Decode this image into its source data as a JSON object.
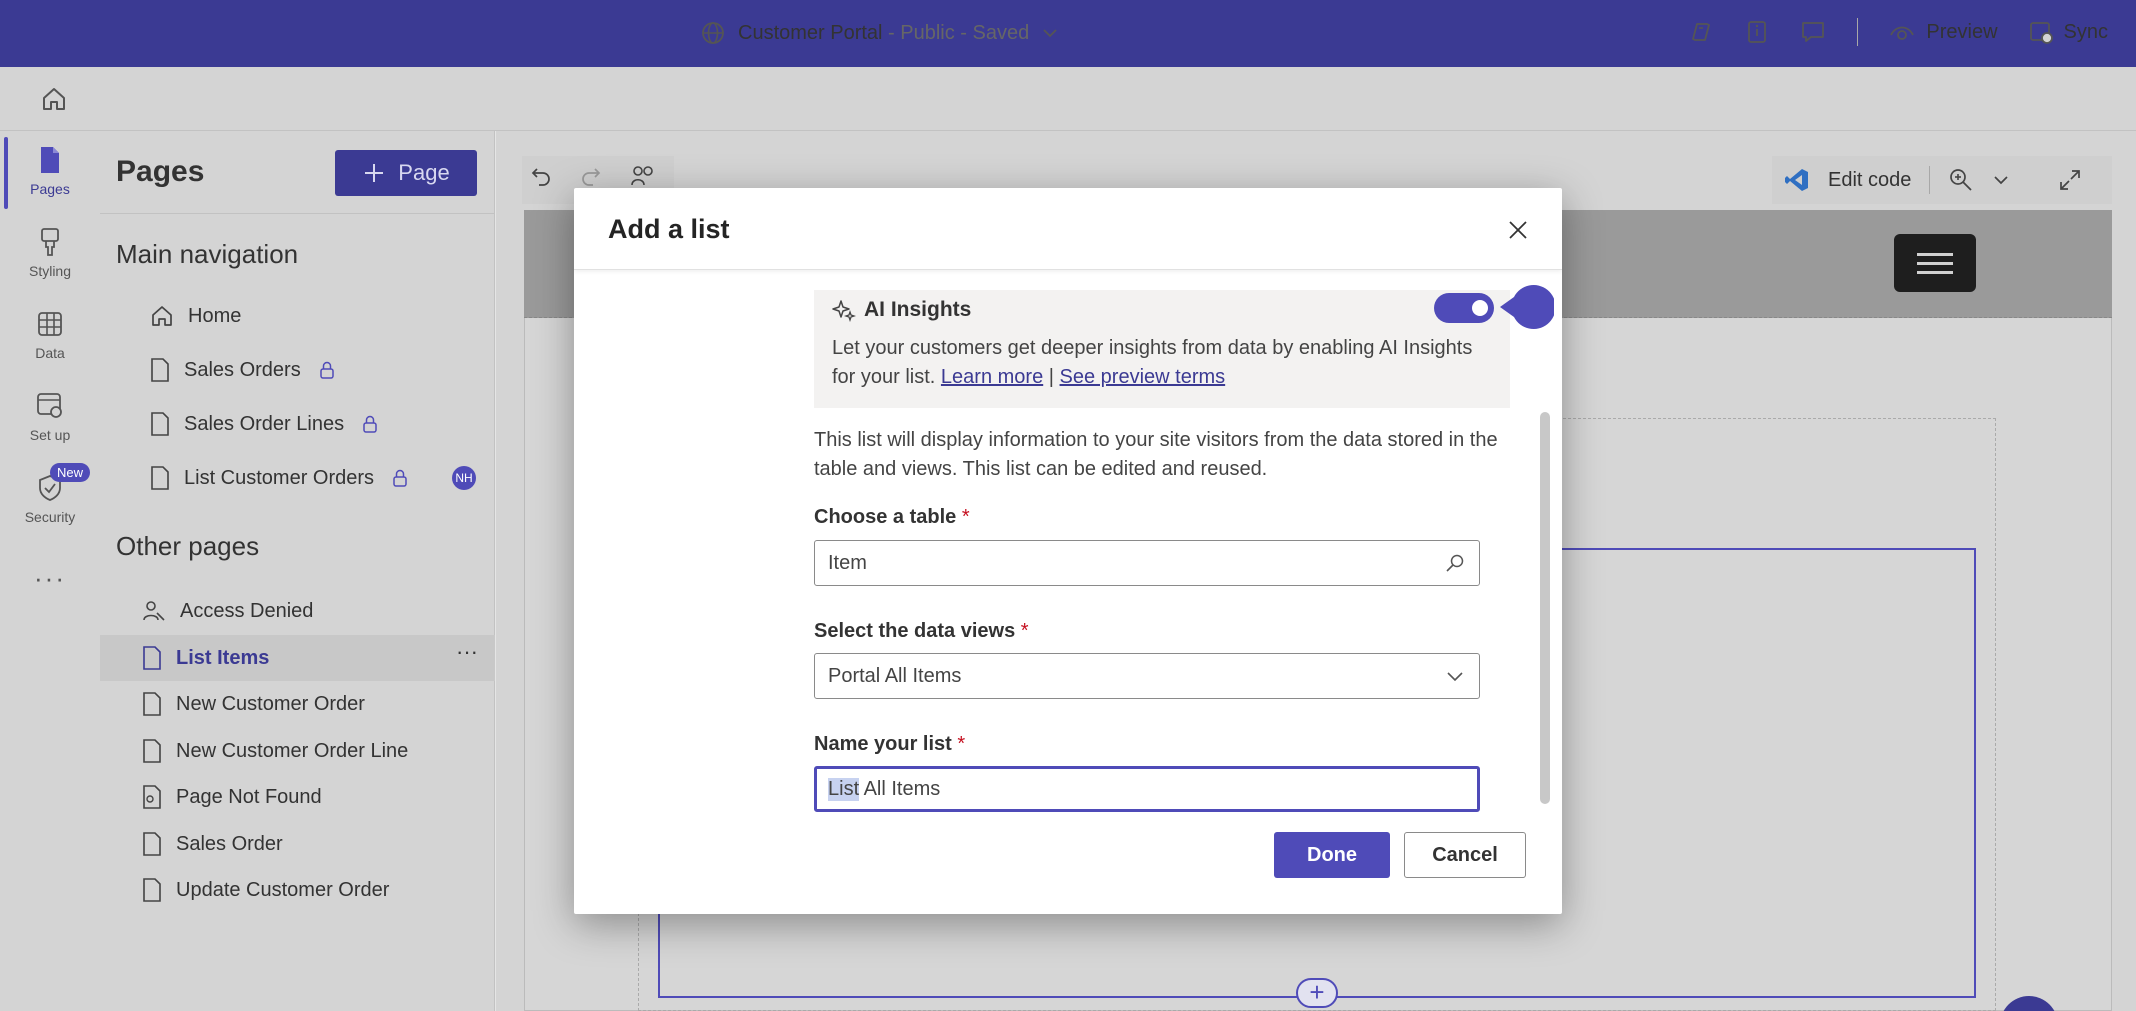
{
  "header": {
    "site_name": "Customer Portal",
    "site_status": " - Public - Saved",
    "preview_label": "Preview",
    "sync_label": "Sync"
  },
  "rail": {
    "items": [
      {
        "label": "Pages",
        "icon": "page-icon"
      },
      {
        "label": "Styling",
        "icon": "brush-icon"
      },
      {
        "label": "Data",
        "icon": "table-icon"
      },
      {
        "label": "Set up",
        "icon": "setup-icon"
      },
      {
        "label": "Security",
        "icon": "shield-icon"
      }
    ],
    "new_badge": "New",
    "more": "···"
  },
  "pages_panel": {
    "title": "Pages",
    "add_button": "Page",
    "main_nav_title": "Main navigation",
    "main_nav": [
      {
        "label": "Home"
      },
      {
        "label": "Sales Orders"
      },
      {
        "label": "Sales Order Lines"
      },
      {
        "label": "List Customer Orders"
      }
    ],
    "avatar_initials": "NH",
    "other_pages_title": "Other pages",
    "other_pages": [
      {
        "label": "Access Denied"
      },
      {
        "label": "List Items"
      },
      {
        "label": "New Customer Order"
      },
      {
        "label": "New Customer Order Line"
      },
      {
        "label": "Page Not Found"
      },
      {
        "label": "Sales Order"
      },
      {
        "label": "Update Customer Order"
      }
    ],
    "row_more": "···"
  },
  "canvas": {
    "edit_code_label": "Edit code"
  },
  "dialog": {
    "title": "Add a list",
    "ai": {
      "title": "AI Insights",
      "text": "Let your customers get deeper insights from data by enabling AI Insights for your list.",
      "learn_more": "Learn more",
      "separator": "|",
      "preview_terms": "See preview terms",
      "enabled": true
    },
    "description": "This list will display information to your site visitors from the data stored in the table and views. This list can be edited and reused.",
    "table_label": "Choose a table",
    "table_value": "Item",
    "views_label": "Select the data views",
    "views_value": "Portal All Items",
    "name_label": "Name your list",
    "name_value_selected": "List",
    "name_value_rest": " All Items",
    "required_mark": "*",
    "done_label": "Done",
    "cancel_label": "Cancel"
  },
  "colors": {
    "brand": "#3b3a93",
    "accent": "#4f4bb8",
    "required": "#c50f1f"
  }
}
